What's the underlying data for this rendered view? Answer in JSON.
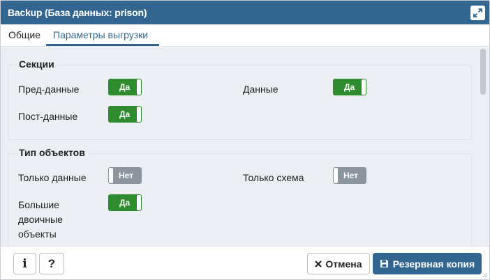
{
  "window": {
    "title": "Backup (База данных: prison)",
    "maximize_icon": "expand-icon"
  },
  "tabs": [
    {
      "label": "Общие",
      "active": false
    },
    {
      "label": "Параметры выгрузки",
      "active": true
    }
  ],
  "sections": {
    "legend": "Секции",
    "options": [
      {
        "label": "Пред-данные",
        "state": "Да",
        "on": true
      },
      {
        "label": "Данные",
        "state": "Да",
        "on": true
      },
      {
        "label": "Пост-данные",
        "state": "Да",
        "on": true
      }
    ]
  },
  "object_types": {
    "legend": "Тип объектов",
    "options": [
      {
        "label": "Только данные",
        "state": "Нет",
        "on": false
      },
      {
        "label": "Только схема",
        "state": "Нет",
        "on": false
      },
      {
        "label_lines": [
          "Большие",
          "двоичные",
          "объекты"
        ],
        "state": "Да",
        "on": true
      }
    ]
  },
  "footer": {
    "info_label": "i",
    "help_label": "?",
    "cancel_label": "Отмена",
    "backup_label": "Резервная копия"
  },
  "colors": {
    "titlebar": "#326690",
    "toggle_on": "#2e8b2e",
    "toggle_off": "#8c959e",
    "content_bg": "#ebeef3"
  }
}
